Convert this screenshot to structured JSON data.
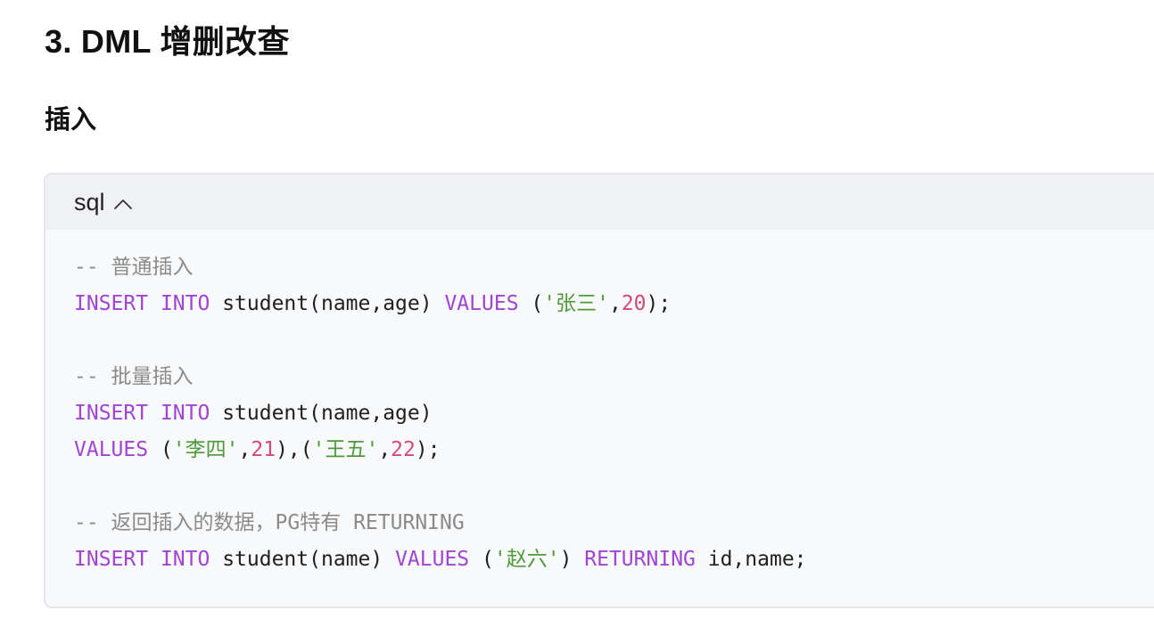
{
  "heading": "3. DML 增删改查",
  "subheading": "插入",
  "code_block": {
    "language": "sql",
    "lines": [
      [
        {
          "t": "comment",
          "v": "-- 普通插入"
        }
      ],
      [
        {
          "t": "kw",
          "v": "INSERT"
        },
        {
          "t": "plain",
          "v": " "
        },
        {
          "t": "kw",
          "v": "INTO"
        },
        {
          "t": "plain",
          "v": " student(name,age) "
        },
        {
          "t": "kw",
          "v": "VALUES"
        },
        {
          "t": "plain",
          "v": " ("
        },
        {
          "t": "str",
          "v": "'张三'"
        },
        {
          "t": "plain",
          "v": ","
        },
        {
          "t": "num",
          "v": "20"
        },
        {
          "t": "plain",
          "v": ");"
        }
      ],
      [],
      [
        {
          "t": "comment",
          "v": "-- 批量插入"
        }
      ],
      [
        {
          "t": "kw",
          "v": "INSERT"
        },
        {
          "t": "plain",
          "v": " "
        },
        {
          "t": "kw",
          "v": "INTO"
        },
        {
          "t": "plain",
          "v": " student(name,age)"
        }
      ],
      [
        {
          "t": "kw",
          "v": "VALUES"
        },
        {
          "t": "plain",
          "v": " ("
        },
        {
          "t": "str",
          "v": "'李四'"
        },
        {
          "t": "plain",
          "v": ","
        },
        {
          "t": "num",
          "v": "21"
        },
        {
          "t": "plain",
          "v": "),("
        },
        {
          "t": "str",
          "v": "'王五'"
        },
        {
          "t": "plain",
          "v": ","
        },
        {
          "t": "num",
          "v": "22"
        },
        {
          "t": "plain",
          "v": ");"
        }
      ],
      [],
      [
        {
          "t": "comment",
          "v": "-- 返回插入的数据，PG特有 RETURNING"
        }
      ],
      [
        {
          "t": "kw",
          "v": "INSERT"
        },
        {
          "t": "plain",
          "v": " "
        },
        {
          "t": "kw",
          "v": "INTO"
        },
        {
          "t": "plain",
          "v": " student(name) "
        },
        {
          "t": "kw",
          "v": "VALUES"
        },
        {
          "t": "plain",
          "v": " ("
        },
        {
          "t": "str",
          "v": "'赵六'"
        },
        {
          "t": "plain",
          "v": ") "
        },
        {
          "t": "kw",
          "v": "RETURNING"
        },
        {
          "t": "plain",
          "v": " id,name;"
        }
      ]
    ]
  },
  "icons": {
    "collapse": "chevron-up-icon"
  },
  "colors": {
    "keyword": "#a044d4",
    "string": "#4e9a3a",
    "number": "#d24a78",
    "comment": "#8a8a8a"
  }
}
